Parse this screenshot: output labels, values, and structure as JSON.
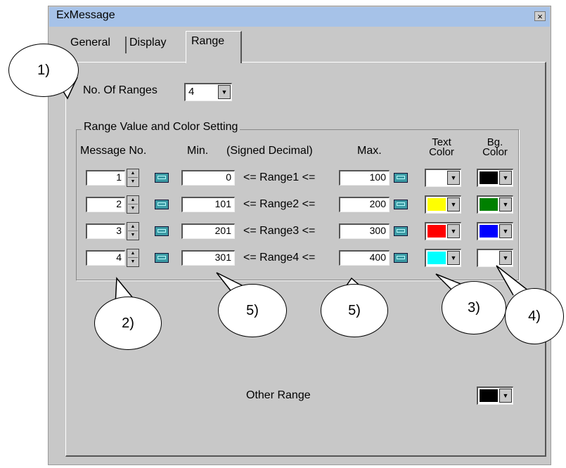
{
  "window": {
    "title": "ExMessage",
    "close_glyph": "×"
  },
  "tabs": [
    {
      "label": "General",
      "active": false
    },
    {
      "label": "Display",
      "active": false
    },
    {
      "label": "Range",
      "active": true
    }
  ],
  "ranges_count": {
    "label": "No. Of Ranges",
    "value": "4"
  },
  "group": {
    "label": "Range Value and Color Setting",
    "headers": {
      "message_no": "Message No.",
      "min": "Min.",
      "signed_decimal": "(Signed Decimal)",
      "max": "Max.",
      "text_color_1": "Text",
      "text_color_2": "Color",
      "bg_color_1": "Bg.",
      "bg_color_2": "Color"
    },
    "rows": [
      {
        "msg": "1",
        "min": "0",
        "label": "<= Range1 <=",
        "max": "100",
        "text_color": "#ffffff",
        "bg_color": "#000000"
      },
      {
        "msg": "2",
        "min": "101",
        "label": "<= Range2 <=",
        "max": "200",
        "text_color": "#ffff00",
        "bg_color": "#008000"
      },
      {
        "msg": "3",
        "min": "201",
        "label": "<= Range3 <=",
        "max": "300",
        "text_color": "#ff0000",
        "bg_color": "#0000ff"
      },
      {
        "msg": "4",
        "min": "301",
        "label": "<= Range4 <=",
        "max": "400",
        "text_color": "#00ffff",
        "bg_color": "#ffffff"
      }
    ]
  },
  "other_range": {
    "label": "Other Range",
    "color": "#000000"
  },
  "callouts": [
    "1)",
    "2)",
    "5)",
    "5)",
    "3)",
    "4)"
  ]
}
